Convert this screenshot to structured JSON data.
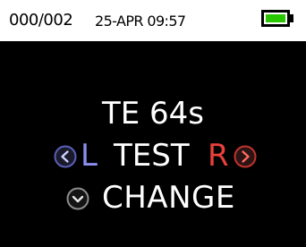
{
  "status_bar": {
    "record_counter": "000/002",
    "datetime": "25-APR 09:57",
    "battery_level": 1.0,
    "battery_color": "#29c700"
  },
  "main": {
    "time_text": "TE 64s",
    "ear_left": "L",
    "test_label": "TEST",
    "ear_right": "R",
    "change_label": "CHANGE"
  },
  "icons": {
    "prev": "chevron-left-icon",
    "next": "chevron-right-icon",
    "down": "chevron-down-icon"
  },
  "colors": {
    "background": "#000000",
    "statusbar": "#ffffff",
    "left_ear": "#8a8ef0",
    "right_ear": "#e8403a",
    "nav_left_ring": "#5a5fb8",
    "nav_right_ring": "#c2332e"
  }
}
